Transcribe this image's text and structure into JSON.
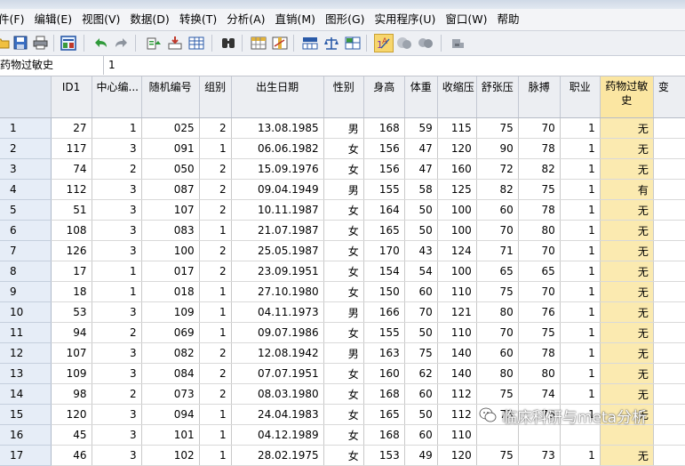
{
  "menus": [
    "件(F)",
    "编辑(E)",
    "视图(V)",
    "数据(D)",
    "转换(T)",
    "分析(A)",
    "直销(M)",
    "图形(G)",
    "实用程序(U)",
    "窗口(W)",
    "帮助"
  ],
  "toolbar": {
    "icons": [
      "open-folder-icon",
      "save-icon",
      "print-icon",
      "dialog-recall-icon",
      "undo-icon",
      "redo-icon",
      "goto-case-icon",
      "goto-variable-icon",
      "variables-icon",
      "find-icon",
      "insert-cases-icon",
      "insert-variable-icon",
      "split-file-icon",
      "weight-cases-icon",
      "select-cases-icon",
      "value-labels-icon",
      "use-sets-icon",
      "show-all-variables-icon",
      "spell-check-icon"
    ]
  },
  "cell_editor": {
    "variable": "药物过敏史",
    "value": "1"
  },
  "columns": [
    "ID1",
    "中心编...",
    "随机编号",
    "组别",
    "出生日期",
    "性别",
    "身高",
    "体重",
    "收缩压",
    "舒张压",
    "脉搏",
    "职业",
    "药物过敏史",
    "变"
  ],
  "rows": [
    {
      "n": "1",
      "cells": [
        "27",
        "1",
        "025",
        "2",
        "13.08.1985",
        "男",
        "168",
        "59",
        "115",
        "75",
        "70",
        "1",
        "无"
      ]
    },
    {
      "n": "2",
      "cells": [
        "117",
        "3",
        "091",
        "1",
        "06.06.1982",
        "女",
        "156",
        "47",
        "120",
        "90",
        "78",
        "1",
        "无"
      ]
    },
    {
      "n": "3",
      "cells": [
        "74",
        "2",
        "050",
        "2",
        "15.09.1976",
        "女",
        "156",
        "47",
        "160",
        "72",
        "82",
        "1",
        "无"
      ]
    },
    {
      "n": "4",
      "cells": [
        "112",
        "3",
        "087",
        "2",
        "09.04.1949",
        "男",
        "155",
        "58",
        "125",
        "82",
        "75",
        "1",
        "有"
      ]
    },
    {
      "n": "5",
      "cells": [
        "51",
        "3",
        "107",
        "2",
        "10.11.1987",
        "女",
        "164",
        "50",
        "100",
        "60",
        "78",
        "1",
        "无"
      ]
    },
    {
      "n": "6",
      "cells": [
        "108",
        "3",
        "083",
        "1",
        "21.07.1987",
        "女",
        "165",
        "50",
        "100",
        "70",
        "80",
        "1",
        "无"
      ]
    },
    {
      "n": "7",
      "cells": [
        "126",
        "3",
        "100",
        "2",
        "25.05.1987",
        "女",
        "170",
        "43",
        "124",
        "71",
        "70",
        "1",
        "无"
      ]
    },
    {
      "n": "8",
      "cells": [
        "17",
        "1",
        "017",
        "2",
        "23.09.1951",
        "女",
        "154",
        "54",
        "100",
        "65",
        "65",
        "1",
        "无"
      ]
    },
    {
      "n": "9",
      "cells": [
        "18",
        "1",
        "018",
        "1",
        "27.10.1980",
        "女",
        "150",
        "60",
        "110",
        "75",
        "70",
        "1",
        "无"
      ]
    },
    {
      "n": "10",
      "cells": [
        "53",
        "3",
        "109",
        "1",
        "04.11.1973",
        "男",
        "166",
        "70",
        "121",
        "80",
        "76",
        "1",
        "无"
      ]
    },
    {
      "n": "11",
      "cells": [
        "94",
        "2",
        "069",
        "1",
        "09.07.1986",
        "女",
        "155",
        "50",
        "110",
        "70",
        "75",
        "1",
        "无"
      ]
    },
    {
      "n": "12",
      "cells": [
        "107",
        "3",
        "082",
        "2",
        "12.08.1942",
        "男",
        "163",
        "75",
        "140",
        "60",
        "78",
        "1",
        "无"
      ]
    },
    {
      "n": "13",
      "cells": [
        "109",
        "3",
        "084",
        "2",
        "07.07.1951",
        "女",
        "160",
        "62",
        "140",
        "80",
        "80",
        "1",
        "无"
      ]
    },
    {
      "n": "14",
      "cells": [
        "98",
        "2",
        "073",
        "2",
        "08.03.1980",
        "女",
        "168",
        "60",
        "112",
        "75",
        "74",
        "1",
        "无"
      ]
    },
    {
      "n": "15",
      "cells": [
        "120",
        "3",
        "094",
        "1",
        "24.04.1983",
        "女",
        "165",
        "50",
        "112",
        "73",
        "76",
        "1",
        "无"
      ]
    },
    {
      "n": "16",
      "cells": [
        "45",
        "3",
        "101",
        "1",
        "04.12.1989",
        "女",
        "168",
        "60",
        "110",
        "",
        "",
        "",
        ""
      ]
    },
    {
      "n": "17",
      "cells": [
        "46",
        "3",
        "102",
        "1",
        "28.02.1975",
        "女",
        "153",
        "49",
        "120",
        "75",
        "73",
        "1",
        "无"
      ]
    }
  ],
  "watermark": "临床科研与meta分析",
  "colors": {
    "highlight_column": "#fbeab0",
    "row_header": "#e6edf7",
    "header": "#eceef2"
  }
}
